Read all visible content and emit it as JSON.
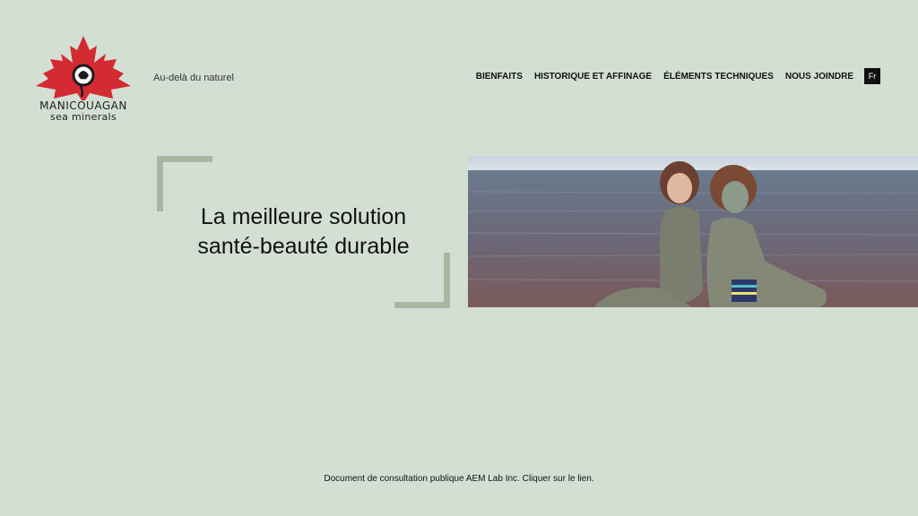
{
  "brand": {
    "name": "MANICOUAGAN",
    "subtitle": "sea minerals",
    "tagline": "Au-delà du naturel",
    "accent_color": "#d42a33"
  },
  "nav": {
    "items": [
      {
        "label": "BIENFAITS"
      },
      {
        "label": "HISTORIQUE ET AFFINAGE"
      },
      {
        "label": "ÉLÉMENTS TECHNIQUES"
      },
      {
        "label": "NOUS JOINDRE"
      }
    ],
    "lang_label": "Fr"
  },
  "hero": {
    "title_line1": "La meilleure solution",
    "title_line2": "santé-beauté durable",
    "bracket_color": "#a9b6a1"
  },
  "footer": {
    "link_text": "Document de consultation publique AEM Lab Inc. Cliquer sur le lien."
  }
}
